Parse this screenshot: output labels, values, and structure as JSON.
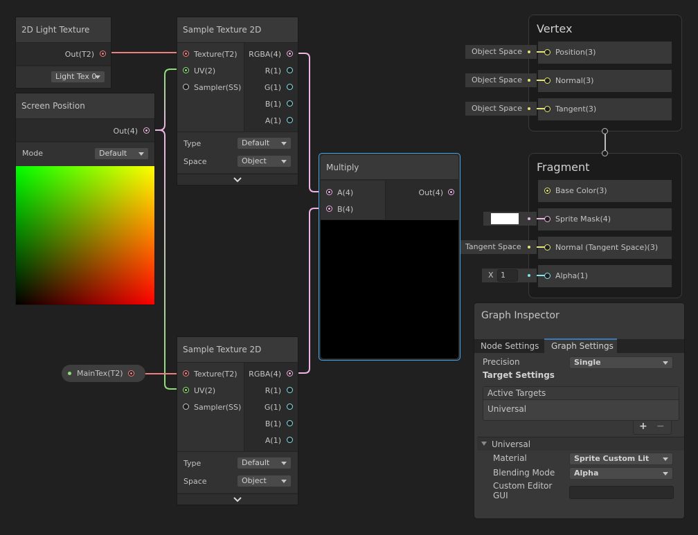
{
  "nodes": {
    "light_texture": {
      "title": "2D Light Texture",
      "output": "Out(T2)",
      "dropdown_value": "Light Tex 0"
    },
    "screen_position": {
      "title": "Screen Position",
      "output": "Out(4)",
      "mode_label": "Mode",
      "mode_value": "Default"
    },
    "sample_tex_top": {
      "title": "Sample Texture 2D",
      "inputs": [
        "Texture(T2)",
        "UV(2)",
        "Sampler(SS)"
      ],
      "outputs": [
        "RGBA(4)",
        "R(1)",
        "G(1)",
        "B(1)",
        "A(1)"
      ],
      "type_label": "Type",
      "type_value": "Default",
      "space_label": "Space",
      "space_value": "Object"
    },
    "sample_tex_bottom": {
      "title": "Sample Texture 2D",
      "inputs": [
        "Texture(T2)",
        "UV(2)",
        "Sampler(SS)"
      ],
      "outputs": [
        "RGBA(4)",
        "R(1)",
        "G(1)",
        "B(1)",
        "A(1)"
      ],
      "type_label": "Type",
      "type_value": "Default",
      "space_label": "Space",
      "space_value": "Object"
    },
    "multiply": {
      "title": "Multiply",
      "inputs": [
        "A(4)",
        "B(4)"
      ],
      "output": "Out(4)"
    },
    "main_tex_property": {
      "label": "MainTex(T2)"
    }
  },
  "vertex": {
    "title": "Vertex",
    "slots": [
      {
        "label": "Position(3)",
        "default": "Object Space"
      },
      {
        "label": "Normal(3)",
        "default": "Object Space"
      },
      {
        "label": "Tangent(3)",
        "default": "Object Space"
      }
    ]
  },
  "fragment": {
    "title": "Fragment",
    "slots": [
      {
        "label": "Base Color(3)"
      },
      {
        "label": "Sprite Mask(4)",
        "default_color": "#ffffff"
      },
      {
        "label": "Normal (Tangent Space)(3)",
        "default": "Tangent Space"
      },
      {
        "label": "Alpha(1)",
        "default_axis": "X",
        "default": "1"
      }
    ]
  },
  "inspector": {
    "title": "Graph Inspector",
    "tabs": [
      {
        "label": "Node Settings",
        "active": false
      },
      {
        "label": "Graph Settings",
        "active": true
      }
    ],
    "precision_label": "Precision",
    "precision_value": "Single",
    "target_settings_label": "Target Settings",
    "active_targets_header": "Active Targets",
    "active_targets": [
      "Universal"
    ],
    "add_symbol": "+",
    "remove_symbol": "−",
    "universal_section": "Universal",
    "material_label": "Material",
    "material_value": "Sprite Custom Lit",
    "blending_label": "Blending Mode",
    "blending_value": "Alpha",
    "custom_editor_label": "Custom Editor GUI",
    "custom_editor_value": ""
  },
  "colors": {
    "texture_port": "#f08080",
    "vector2_port": "#8ee07a",
    "vector4_port": "#f0b4e6",
    "vector1_port": "#84e4e7",
    "vector3_port": "#f6ff9a",
    "selection": "#44a6e8",
    "tab_underline": "#3a79bb"
  }
}
